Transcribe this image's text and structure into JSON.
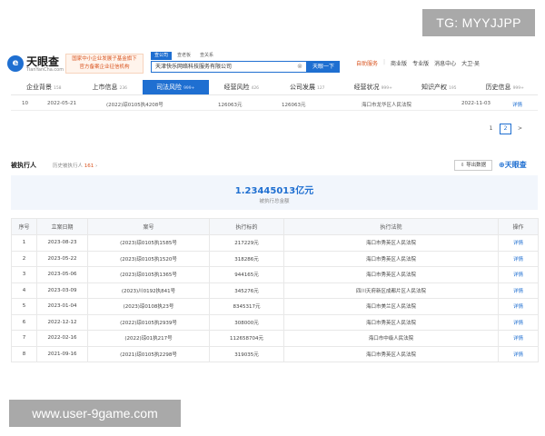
{
  "watermarks": {
    "top": "TG: MYYJJPP",
    "bottom": "www.user-9game.com"
  },
  "header": {
    "logo_mark": "e",
    "logo_name": "天眼查",
    "logo_url": "TianYanCha.com",
    "promo": [
      "国家中小企业发展子基金旗下",
      "官方备案企业征信机构"
    ],
    "search_tabs": [
      "查公司",
      "查老板",
      "查关系"
    ],
    "search_value": "天津快乐网络科技服务有限公司",
    "search_button": "天眼一下",
    "nav": [
      "自助服务",
      "|",
      "商业版",
      "专业版",
      "消息中心",
      "大卫·吴"
    ]
  },
  "tabs": [
    {
      "label": "企业背景",
      "count": "158"
    },
    {
      "label": "上市信息",
      "count": "236"
    },
    {
      "label": "司法风险",
      "count": "999+",
      "active": true
    },
    {
      "label": "经营风险",
      "count": "426"
    },
    {
      "label": "公司发展",
      "count": "127"
    },
    {
      "label": "经营状况",
      "count": "999+"
    },
    {
      "label": "知识产权",
      "count": "195"
    },
    {
      "label": "历史信息",
      "count": "999+"
    }
  ],
  "prev_row": {
    "index": "10",
    "date": "2022-05-21",
    "case_no": "(2022)琼0105执4208号",
    "amount1": "126063元",
    "amount2": "126063元",
    "court": "海口市龙华区人民法院",
    "end_date": "2022-11-03",
    "action": "详情"
  },
  "pager": [
    "1",
    "2",
    ">"
  ],
  "section": {
    "title": "被执行人",
    "sub_prefix": "历史被执行人",
    "sub_count": "161",
    "export": "导出数据",
    "logo": "天眼查"
  },
  "summary": {
    "amount": "1.23445013亿元",
    "label": "被执行总金额"
  },
  "table": {
    "headers": [
      "序号",
      "立案日期",
      "案号",
      "执行标的",
      "执行法院",
      "操作"
    ],
    "rows": [
      [
        "1",
        "2023-08-23",
        "(2023)琼0105执1585号",
        "217229元",
        "海口市秀英区人民法院",
        "详情"
      ],
      [
        "2",
        "2023-05-22",
        "(2023)琼0105执1520号",
        "318286元",
        "海口市秀英区人民法院",
        "详情"
      ],
      [
        "3",
        "2023-05-06",
        "(2023)琼0105执1365号",
        "944165元",
        "海口市秀英区人民法院",
        "详情"
      ],
      [
        "4",
        "2023-03-09",
        "(2023)川0192执841号",
        "345276元",
        "四川天府新区成都片区人民法院",
        "详情"
      ],
      [
        "5",
        "2023-01-04",
        "(2023)琼0108执23号",
        "8345317元",
        "海口市美兰区人民法院",
        "详情"
      ],
      [
        "6",
        "2022-12-12",
        "(2022)琼0105执2939号",
        "308000元",
        "海口市秀英区人民法院",
        "详情"
      ],
      [
        "7",
        "2022-02-16",
        "(2022)琼01执217号",
        "112658704元",
        "海口市中级人民法院",
        "详情"
      ],
      [
        "8",
        "2021-09-16",
        "(2021)琼0105执2298号",
        "319035元",
        "海口市秀英区人民法院",
        "详情"
      ]
    ]
  }
}
